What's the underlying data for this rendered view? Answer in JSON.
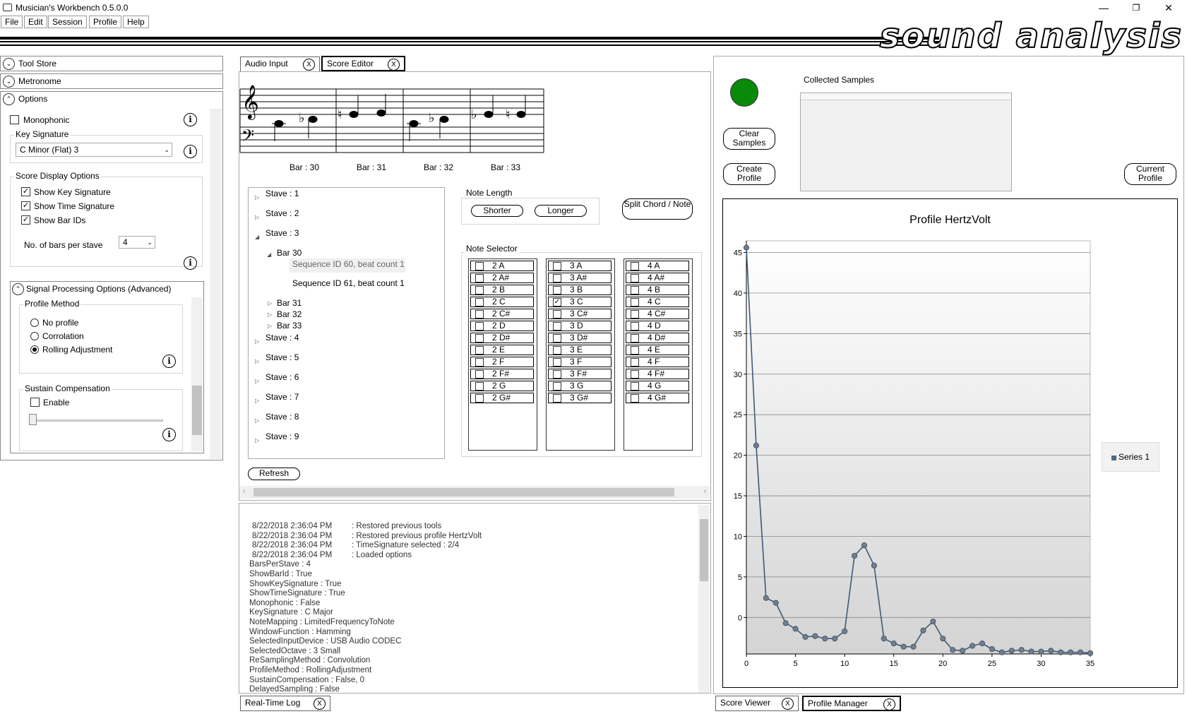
{
  "window": {
    "title": "Musician's Workbench 0.5.0.0",
    "minimize": "—",
    "maximize": "❐",
    "close": "✕"
  },
  "menu": [
    "File",
    "Edit",
    "Session",
    "Profile",
    "Help"
  ],
  "brand": "sound analysis",
  "left": {
    "tool_store": "Tool Store",
    "metronome": "Metronome",
    "options": "Options",
    "monophonic": "Monophonic",
    "key_signature_label": "Key Signature",
    "key_signature_value": "C Minor (Flat)  3",
    "score_display_label": "Score Display Options",
    "show_key_sig": "Show Key Signature",
    "show_time_sig": "Show Time Signature",
    "show_bar_ids": "Show Bar IDs",
    "bars_per_stave_label": "No. of bars per stave",
    "bars_per_stave_value": "4",
    "signal_processing": "Signal Processing Options (Advanced)",
    "profile_method": "Profile Method",
    "radios": [
      "No profile",
      "Corrolation",
      "Rolling Adjustment"
    ],
    "radio_selected": 2,
    "sustain": "Sustain Compensation",
    "enable": "Enable"
  },
  "tabs": {
    "audio_input": "Audio Input",
    "score_editor": "Score Editor",
    "real_time_log": "Real-Time Log",
    "score_viewer": "Score Viewer",
    "profile_manager": "Profile Manager",
    "close": "X"
  },
  "score": {
    "bars": [
      "Bar : 30",
      "Bar : 31",
      "Bar : 32",
      "Bar : 33"
    ]
  },
  "tree": {
    "staves": [
      "Stave : 1",
      "Stave : 2",
      "Stave : 3",
      "Stave : 4",
      "Stave : 5",
      "Stave : 6",
      "Stave : 7",
      "Stave : 8",
      "Stave : 9"
    ],
    "bar30": "Bar 30",
    "seq60": "Sequence ID 60, beat count 1",
    "seq61": "Sequence ID 61, beat count 1",
    "bars": [
      "Bar 31",
      "Bar 32",
      "Bar 33"
    ]
  },
  "note_length": {
    "label": "Note Length",
    "shorter": "Shorter",
    "longer": "Longer"
  },
  "split": "Split Chord / Note",
  "note_selector": {
    "label": "Note Selector",
    "names": [
      "A",
      "A#",
      "B",
      "C",
      "C#",
      "D",
      "D#",
      "E",
      "F",
      "F#",
      "G",
      "G#"
    ],
    "octaves": [
      "2",
      "3",
      "4"
    ],
    "checked": "3 C"
  },
  "refresh": "Refresh",
  "log": {
    "entries": [
      {
        "time": "8/22/2018 2:36:04 PM",
        "msg": ": Restored previous tools"
      },
      {
        "time": "8/22/2018 2:36:04 PM",
        "msg": ": Restored previous profile HertzVolt"
      },
      {
        "time": "8/22/2018 2:36:04 PM",
        "msg": ": TimeSignature selected :  2/4"
      },
      {
        "time": "8/22/2018 2:36:04 PM",
        "msg": ": Loaded options"
      }
    ],
    "lines": [
      "BarsPerStave : 4",
      "ShowBarId : True",
      "ShowKeySignature : True",
      "ShowTimeSignature : True",
      "Monophonic : False",
      "KeySignature : C Major",
      "NoteMapping : LimitedFrequencyToNote",
      "WindowFunction : Hamming",
      "SelectedInputDevice : USB Audio CODEC",
      "SelectedOctave : 3  Small",
      "ReSamplingMethod : Convolution",
      "ProfileMethod : RollingAdjustment",
      "SustainCompensation : False, 0",
      "DelayedSampling : False"
    ]
  },
  "profile": {
    "collected_samples": "Collected Samples",
    "clear": "Clear Samples",
    "create": "Create Profile",
    "current": "Current Profile",
    "status_color": "#0a8a0a"
  },
  "chart_data": {
    "type": "line",
    "title": "Profile HertzVolt",
    "legend": [
      "Series 1"
    ],
    "legend_position": "right",
    "x": [
      0,
      1,
      2,
      3,
      4,
      5,
      6,
      7,
      8,
      9,
      10,
      11,
      12,
      13,
      14,
      15,
      16,
      17,
      18,
      19,
      20,
      21,
      22,
      23,
      24,
      25,
      26,
      27,
      28,
      29,
      30,
      31,
      32,
      33,
      34,
      35
    ],
    "series": [
      {
        "name": "Series 1",
        "values": [
          45.6,
          21.2,
          2.4,
          1.8,
          -0.7,
          -1.4,
          -2.4,
          -2.3,
          -2.6,
          -2.6,
          -1.7,
          7.6,
          8.9,
          6.4,
          -2.6,
          -3.2,
          -3.6,
          -3.6,
          -1.6,
          -0.5,
          -2.6,
          -4.0,
          -4.1,
          -3.5,
          -3.2,
          -3.9,
          -4.3,
          -4.1,
          -4.0,
          -4.2,
          -4.2,
          -4.1,
          -4.3,
          -4.3,
          -4.3,
          -4.4
        ]
      }
    ],
    "xticks": [
      0,
      5,
      10,
      15,
      20,
      25,
      30,
      35
    ],
    "yticks": [
      0,
      5,
      10,
      15,
      20,
      25,
      30,
      35,
      40,
      45
    ],
    "xlim": [
      0,
      35
    ],
    "ylim": [
      -4.5,
      46
    ],
    "grid": true
  }
}
